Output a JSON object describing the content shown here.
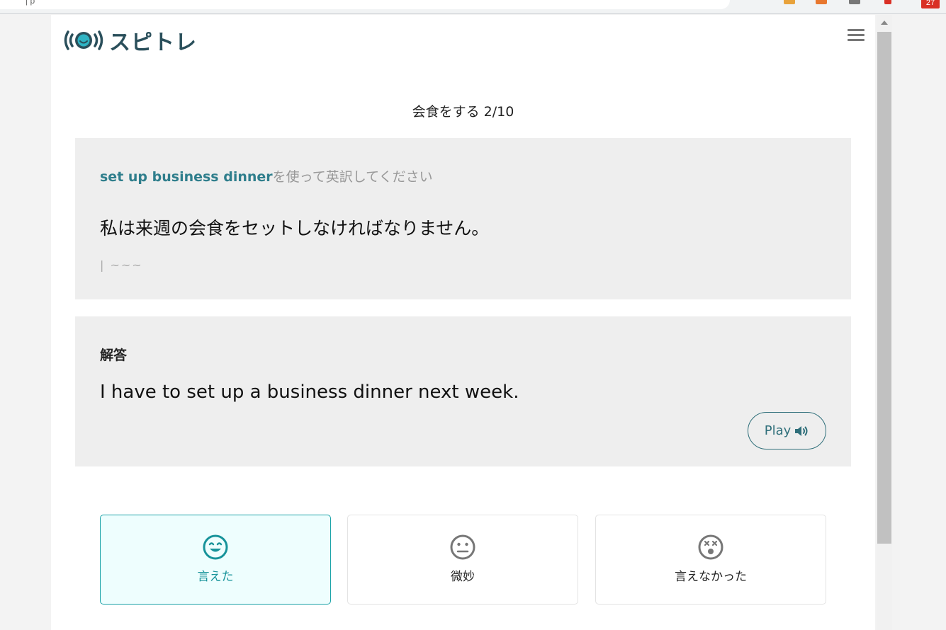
{
  "browser": {
    "url_fragment": "| p",
    "notification_count": "27"
  },
  "app": {
    "name": "スピトレ"
  },
  "progress": {
    "title": "会食をする  2/10"
  },
  "question": {
    "phrase": "set up business dinner",
    "instruction_suffix": "を使って英訳してください",
    "japanese_sentence": "私は来週の会食をセットしなければなりません。",
    "hint": "| ~~~"
  },
  "answer": {
    "label": "解答",
    "text": "I have to set up a business dinner next week.",
    "play_label": "Play"
  },
  "ratings": [
    {
      "label": "言えた",
      "icon": "smile-face-icon",
      "selected": true
    },
    {
      "label": "微妙",
      "icon": "neutral-face-icon",
      "selected": false
    },
    {
      "label": "言えなかった",
      "icon": "dizzy-face-icon",
      "selected": false
    }
  ],
  "colors": {
    "brand": "#2a4f5b",
    "accent": "#2f7e8c",
    "teal": "#1ba3a8",
    "card_bg": "#eeeeee"
  }
}
